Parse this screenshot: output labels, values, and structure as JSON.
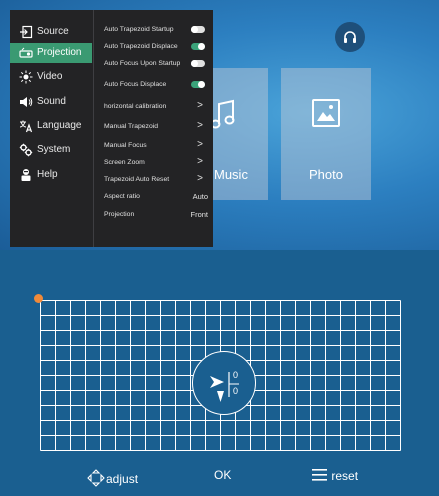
{
  "menu": {
    "categories": [
      {
        "label": "Source",
        "icon": "source-icon",
        "active": false
      },
      {
        "label": "Projection",
        "icon": "projection-icon",
        "active": true
      },
      {
        "label": "Video",
        "icon": "video-icon",
        "active": false
      },
      {
        "label": "Sound",
        "icon": "sound-icon",
        "active": false
      },
      {
        "label": "Language",
        "icon": "language-icon",
        "active": false
      },
      {
        "label": "System",
        "icon": "system-icon",
        "active": false
      },
      {
        "label": "Help",
        "icon": "help-icon",
        "active": false
      }
    ],
    "options": [
      {
        "label": "Auto Trapezoid Startup",
        "control": "toggle",
        "state": "off"
      },
      {
        "label": "Auto Trapezoid Displace",
        "control": "toggle",
        "state": "on"
      },
      {
        "label": "Auto Focus Upon Startup",
        "control": "toggle",
        "state": "off"
      },
      {
        "label": "Auto Focus Displace",
        "control": "toggle",
        "state": "on"
      },
      {
        "label": "horizontal calibration",
        "control": "submenu",
        "symbol": ">"
      },
      {
        "label": "Manual Trapezoid",
        "control": "submenu",
        "symbol": ">"
      },
      {
        "label": "Manual Focus",
        "control": "submenu",
        "symbol": ">"
      },
      {
        "label": "Screen Zoom",
        "control": "submenu",
        "symbol": ">"
      },
      {
        "label": "Trapezoid Auto Reset",
        "control": "submenu",
        "symbol": ">"
      },
      {
        "label": "Aspect ratio",
        "control": "value",
        "value": "Auto"
      },
      {
        "label": "Projection",
        "control": "value",
        "value": "Front"
      }
    ]
  },
  "cards": {
    "music": {
      "label": "Music",
      "icon": "music-note-icon"
    },
    "photo": {
      "label": "Photo",
      "icon": "photo-icon"
    }
  },
  "headphones_icon": "headphones-icon",
  "trapezoid": {
    "horizontal_value": "0",
    "vertical_value": "0",
    "selected_corner": "top-left",
    "corner_color": "#f08a3a",
    "grid_color": "#ffffff",
    "background_color": "#1a5f90"
  },
  "bottom_bar": {
    "adjust_label": "adjust",
    "ok_label": "OK",
    "reset_label": "reset"
  },
  "colors": {
    "menu_background": "#232325",
    "active_category": "#3a9a72",
    "toggle_on": "#3aa37a"
  }
}
